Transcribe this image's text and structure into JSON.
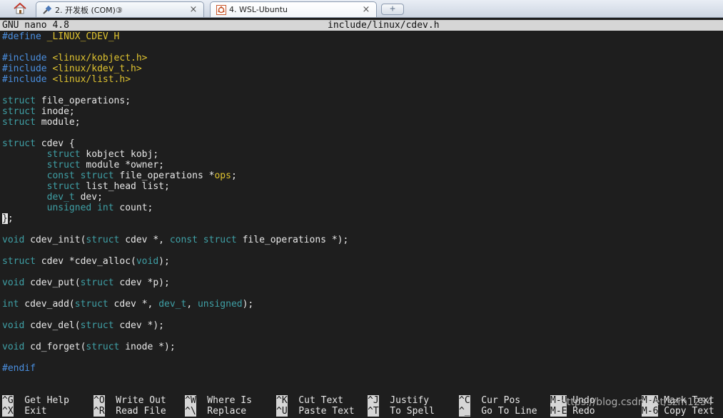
{
  "tabs": [
    {
      "label": "2. 开发板 (COM)③",
      "icon": "plug-icon",
      "active": false
    },
    {
      "label": "4. WSL-Ubuntu",
      "icon": "ubuntu-icon",
      "active": true
    }
  ],
  "tab_close_glyph": "×",
  "new_tab_glyph": "+",
  "titlebar": {
    "app": "GNU nano 4.8",
    "file": "include/linux/cdev.h"
  },
  "code_lines": [
    [
      {
        "t": "#define ",
        "c": "pp"
      },
      {
        "t": "_LINUX_CDEV_H",
        "c": "yl"
      }
    ],
    [],
    [
      {
        "t": "#include ",
        "c": "pp"
      },
      {
        "t": "<linux/kobject.h>",
        "c": "yl"
      }
    ],
    [
      {
        "t": "#include ",
        "c": "pp"
      },
      {
        "t": "<linux/kdev_t.h>",
        "c": "yl"
      }
    ],
    [
      {
        "t": "#include ",
        "c": "pp"
      },
      {
        "t": "<linux/list.h>",
        "c": "yl"
      }
    ],
    [],
    [
      {
        "t": "struct",
        "c": "kw"
      },
      {
        "t": " file_operations;"
      }
    ],
    [
      {
        "t": "struct",
        "c": "kw"
      },
      {
        "t": " inode;"
      }
    ],
    [
      {
        "t": "struct",
        "c": "kw"
      },
      {
        "t": " module;"
      }
    ],
    [],
    [
      {
        "t": "struct",
        "c": "kw"
      },
      {
        "t": " cdev {"
      }
    ],
    [
      {
        "t": "        "
      },
      {
        "t": "struct",
        "c": "kw"
      },
      {
        "t": " kobject kobj;"
      }
    ],
    [
      {
        "t": "        "
      },
      {
        "t": "struct",
        "c": "kw"
      },
      {
        "t": " module *owner;"
      }
    ],
    [
      {
        "t": "        "
      },
      {
        "t": "const",
        "c": "kw"
      },
      {
        "t": " "
      },
      {
        "t": "struct",
        "c": "kw"
      },
      {
        "t": " file_operations *"
      },
      {
        "t": "ops",
        "c": "yl"
      },
      {
        "t": ";"
      }
    ],
    [
      {
        "t": "        "
      },
      {
        "t": "struct",
        "c": "kw"
      },
      {
        "t": " list_head list;"
      }
    ],
    [
      {
        "t": "        "
      },
      {
        "t": "dev_t",
        "c": "kw"
      },
      {
        "t": " dev;"
      }
    ],
    [
      {
        "t": "        "
      },
      {
        "t": "unsigned",
        "c": "kw"
      },
      {
        "t": " "
      },
      {
        "t": "int",
        "c": "kw"
      },
      {
        "t": " count;"
      }
    ],
    [
      {
        "t": "}",
        "c": "cursor"
      },
      {
        "t": ";"
      }
    ],
    [],
    [
      {
        "t": "void",
        "c": "kw"
      },
      {
        "t": " cdev_init("
      },
      {
        "t": "struct",
        "c": "kw"
      },
      {
        "t": " cdev *, "
      },
      {
        "t": "const",
        "c": "kw"
      },
      {
        "t": " "
      },
      {
        "t": "struct",
        "c": "kw"
      },
      {
        "t": " file_operations *);"
      }
    ],
    [],
    [
      {
        "t": "struct",
        "c": "kw"
      },
      {
        "t": " cdev *cdev_alloc("
      },
      {
        "t": "void",
        "c": "kw"
      },
      {
        "t": ");"
      }
    ],
    [],
    [
      {
        "t": "void",
        "c": "kw"
      },
      {
        "t": " cdev_put("
      },
      {
        "t": "struct",
        "c": "kw"
      },
      {
        "t": " cdev *p);"
      }
    ],
    [],
    [
      {
        "t": "int",
        "c": "kw"
      },
      {
        "t": " cdev_add("
      },
      {
        "t": "struct",
        "c": "kw"
      },
      {
        "t": " cdev *, "
      },
      {
        "t": "dev_t",
        "c": "kw"
      },
      {
        "t": ", "
      },
      {
        "t": "unsigned",
        "c": "kw"
      },
      {
        "t": ");"
      }
    ],
    [],
    [
      {
        "t": "void",
        "c": "kw"
      },
      {
        "t": " cdev_del("
      },
      {
        "t": "struct",
        "c": "kw"
      },
      {
        "t": " cdev *);"
      }
    ],
    [],
    [
      {
        "t": "void",
        "c": "kw"
      },
      {
        "t": " cd_forget("
      },
      {
        "t": "struct",
        "c": "kw"
      },
      {
        "t": " inode *);"
      }
    ],
    [],
    [
      {
        "t": "#endif",
        "c": "pp"
      }
    ]
  ],
  "shortcuts_row1": [
    {
      "key": "^G",
      "label": "Get Help"
    },
    {
      "key": "^O",
      "label": "Write Out"
    },
    {
      "key": "^W",
      "label": "Where Is"
    },
    {
      "key": "^K",
      "label": "Cut Text"
    },
    {
      "key": "^J",
      "label": "Justify"
    },
    {
      "key": "^C",
      "label": "Cur Pos"
    },
    {
      "key": "M-U",
      "label": "Undo"
    },
    {
      "key": "M-A",
      "label": "Mark Text"
    }
  ],
  "shortcuts_row2": [
    {
      "key": "^X",
      "label": "Exit"
    },
    {
      "key": "^R",
      "label": "Read File"
    },
    {
      "key": "^\\",
      "label": "Replace"
    },
    {
      "key": "^U",
      "label": "Paste Text"
    },
    {
      "key": "^T",
      "label": "To Spell"
    },
    {
      "key": "^_",
      "label": "Go To Line"
    },
    {
      "key": "M-E",
      "label": "Redo"
    },
    {
      "key": "M-6",
      "label": "Copy Text"
    }
  ],
  "watermark": "https://blog.csdn.net/szm1234"
}
